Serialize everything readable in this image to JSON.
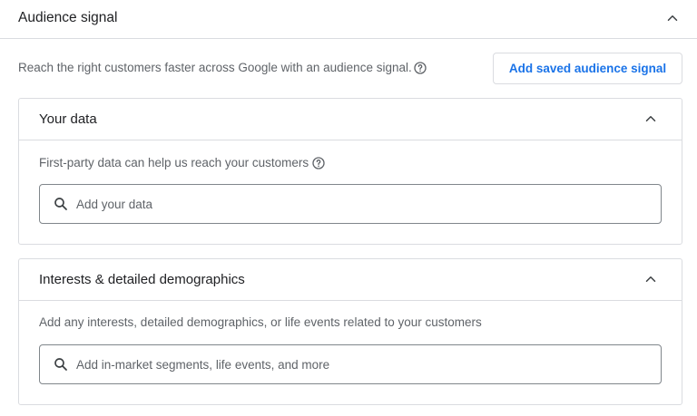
{
  "section": {
    "title": "Audience signal",
    "intro": "Reach the right customers faster across Google with an audience signal.",
    "add_saved_label": "Add saved audience signal"
  },
  "your_data": {
    "title": "Your data",
    "description": "First-party data can help us reach your customers",
    "search_placeholder": "Add your data"
  },
  "interests": {
    "title": "Interests & detailed demographics",
    "description": "Add any interests, detailed demographics, or life events related to your customers",
    "search_placeholder": "Add in-market segments, life events, and more"
  },
  "icons": {
    "collapse": "chevron-up-icon",
    "help": "help-circle-icon",
    "search": "search-icon"
  },
  "colors": {
    "accent": "#1a73e8",
    "border": "#dadce0",
    "text_primary": "#202124",
    "text_secondary": "#5f6368"
  }
}
